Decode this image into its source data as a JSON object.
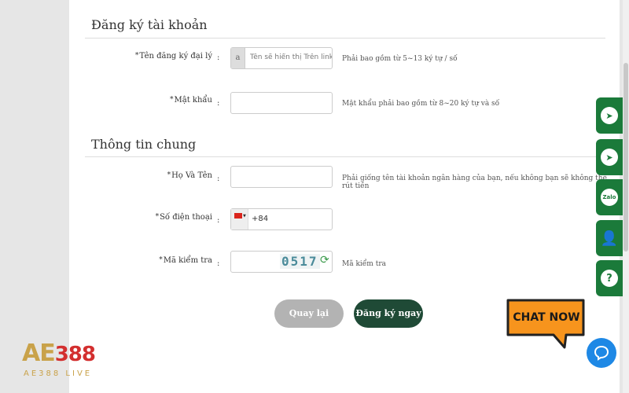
{
  "form": {
    "section_account": "Đăng ký tài khoản",
    "section_general": "Thông tin chung",
    "fields": {
      "username": {
        "label": "Tên đăng ký đại lý",
        "prefix": "a",
        "placeholder": "Tên sẽ hiển thị Trên link đa",
        "hint": "Phải bao gồm từ 5~13 ký tự / số"
      },
      "password": {
        "label": "Mật khẩu",
        "hint": "Mật khẩu phải bao gồm từ 8~20 ký tự và số"
      },
      "fullname": {
        "label": "Họ Và Tên",
        "hint": "Phải giống tên tài khoản ngân hàng của bạn, nếu không bạn sẽ không thể rút tiền"
      },
      "phone": {
        "label": "Số điện thoại",
        "code": "+84"
      },
      "captcha": {
        "label": "Mã kiểm tra",
        "code": "0517",
        "hint": "Mã kiểm tra"
      }
    },
    "required_mark": "*",
    "colon": ":",
    "back_button": "Quay lại",
    "submit_button": "Đăng ký ngay"
  },
  "side_buttons": [
    {
      "icon": "telegram-icon",
      "glyph": "➤"
    },
    {
      "icon": "telegram-icon",
      "glyph": "➤"
    },
    {
      "icon": "zalo-icon",
      "glyph": "Zalo"
    },
    {
      "icon": "user-icon",
      "glyph": "👤"
    },
    {
      "icon": "help-icon",
      "glyph": "?"
    }
  ],
  "chat": {
    "label": "CHAT NOW"
  },
  "logo": {
    "brand": "AE388",
    "sub": "AE388 LIVE"
  },
  "colors": {
    "green": "#1b7a3a",
    "dark_green": "#1f4a36",
    "gray_button": "#b3b3b3",
    "chat_orange": "#f7941d",
    "chat_blue": "#1e88e5"
  }
}
